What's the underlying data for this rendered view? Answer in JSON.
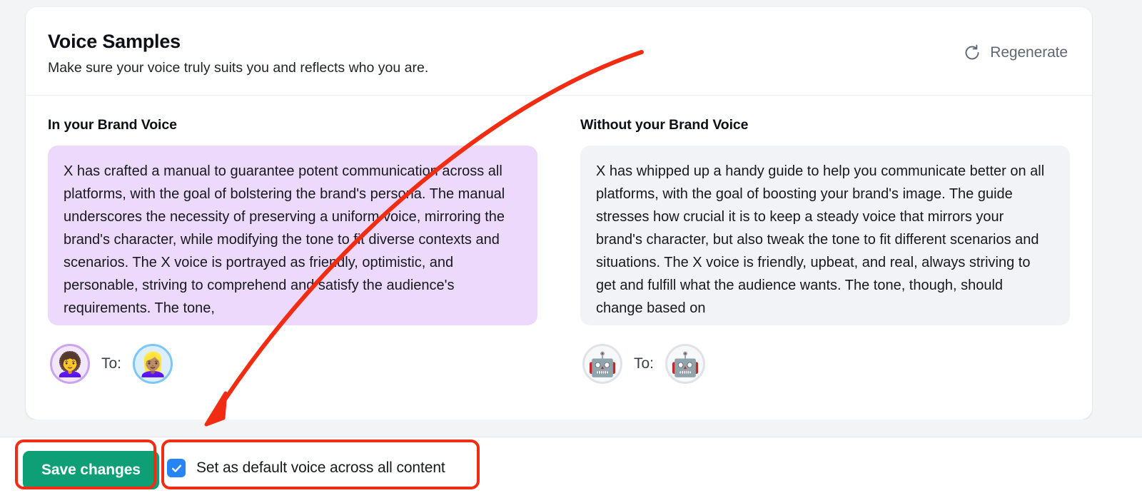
{
  "header": {
    "title": "Voice Samples",
    "subtitle": "Make sure your voice truly suits you and reflects who you are.",
    "regenerate_label": "Regenerate",
    "regenerate_icon": "refresh-icon"
  },
  "columns": [
    {
      "heading": "In your Brand Voice",
      "style": "brand",
      "text": "X has crafted a manual to guarantee potent communication across all platforms, with the goal of bolstering the brand's persona. The manual underscores the necessity of preserving a uniform voice, mirroring the brand's character, while modifying the tone to fit diverse contexts and scenarios. The X voice is portrayed as friendly, optimistic, and personable, striving to comprehend and satisfy the audience's requirements. The tone,",
      "from_avatar": "👩‍🦱",
      "to_label": "To:",
      "to_avatar": "👱🏽‍♀️"
    },
    {
      "heading": "Without your Brand Voice",
      "style": "plain",
      "text": "X has whipped up a handy guide to help you communicate better on all platforms, with the goal of boosting your brand's image. The guide stresses how crucial it is to keep a steady voice that mirrors your brand's character, but also tweak the tone to fit different scenarios and situations. The X voice is friendly, upbeat, and real, always striving to get and fulfill what the audience wants. The tone, though, should change based on",
      "from_avatar": "🤖",
      "to_label": "To:",
      "to_avatar": "🤖"
    }
  ],
  "footer": {
    "save_label": "Save changes",
    "checkbox_label": "Set as default voice across all content",
    "checkbox_checked": true
  },
  "colors": {
    "page_background": "#f3f4f6",
    "card_background": "#ffffff",
    "brand_bubble": "#ecd9fb",
    "plain_bubble": "#f2f3f6",
    "save_button": "#0e9f77",
    "checkbox_blue": "#2684f5",
    "annotation_red": "#f02d13"
  }
}
